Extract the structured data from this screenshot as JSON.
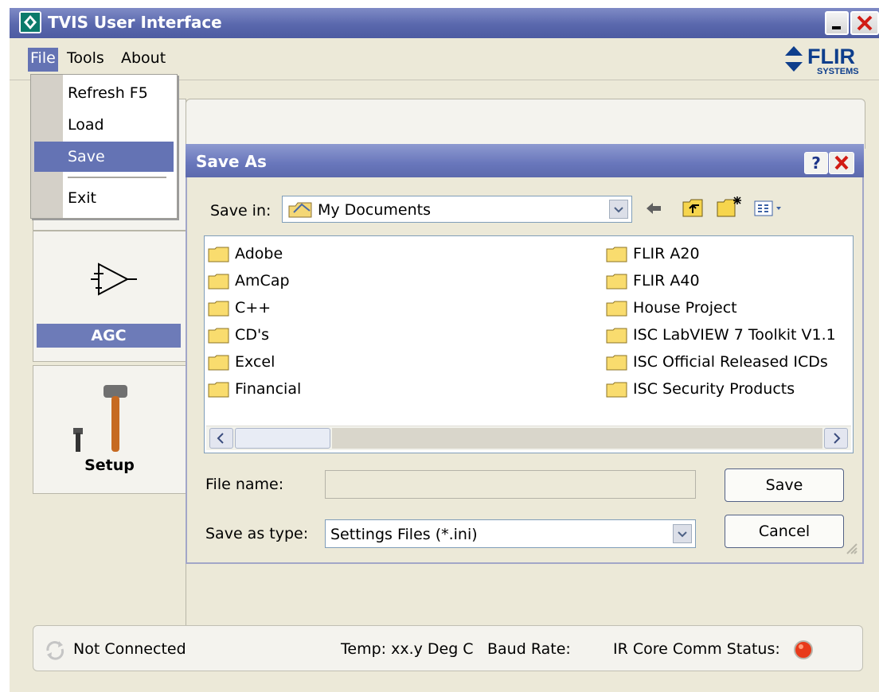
{
  "window": {
    "title": "TVIS User Interface"
  },
  "menu": {
    "file": "File",
    "tools": "Tools",
    "about": "About"
  },
  "logo": {
    "brand": "FLIR",
    "sub": "SYSTEMS"
  },
  "file_menu": {
    "items": [
      "Refresh F5",
      "Load",
      "Save",
      "Exit"
    ],
    "selected": "Save"
  },
  "left_panel": {
    "agc_label": "AGC",
    "setup_label": "Setup"
  },
  "dialog": {
    "title": "Save As",
    "save_in_label": "Save in:",
    "save_in_value": "My Documents",
    "files_left": [
      "Adobe",
      "AmCap",
      "C++",
      "CD's",
      "Excel",
      "Financial"
    ],
    "files_right": [
      "FLIR A20",
      "FLIR A40",
      "House Project",
      "ISC LabVIEW 7 Toolkit V1.1",
      "ISC Official Released ICDs",
      "ISC Security Products"
    ],
    "file_name_label": "File name:",
    "file_name_value": "",
    "save_type_label": "Save as type:",
    "save_type_value": "Settings Files (*.ini)",
    "save_button": "Save",
    "cancel_button": "Cancel"
  },
  "status": {
    "connection": "Not Connected",
    "temp": "Temp: xx.y Deg C",
    "baud": "Baud Rate:",
    "ir_status": "IR Core Comm Status:"
  },
  "colors": {
    "titlebar": "#5a68ad",
    "close_button": "#cc2a1a",
    "selected_menu": "#6473b4",
    "status_led": "#e83a1a"
  }
}
